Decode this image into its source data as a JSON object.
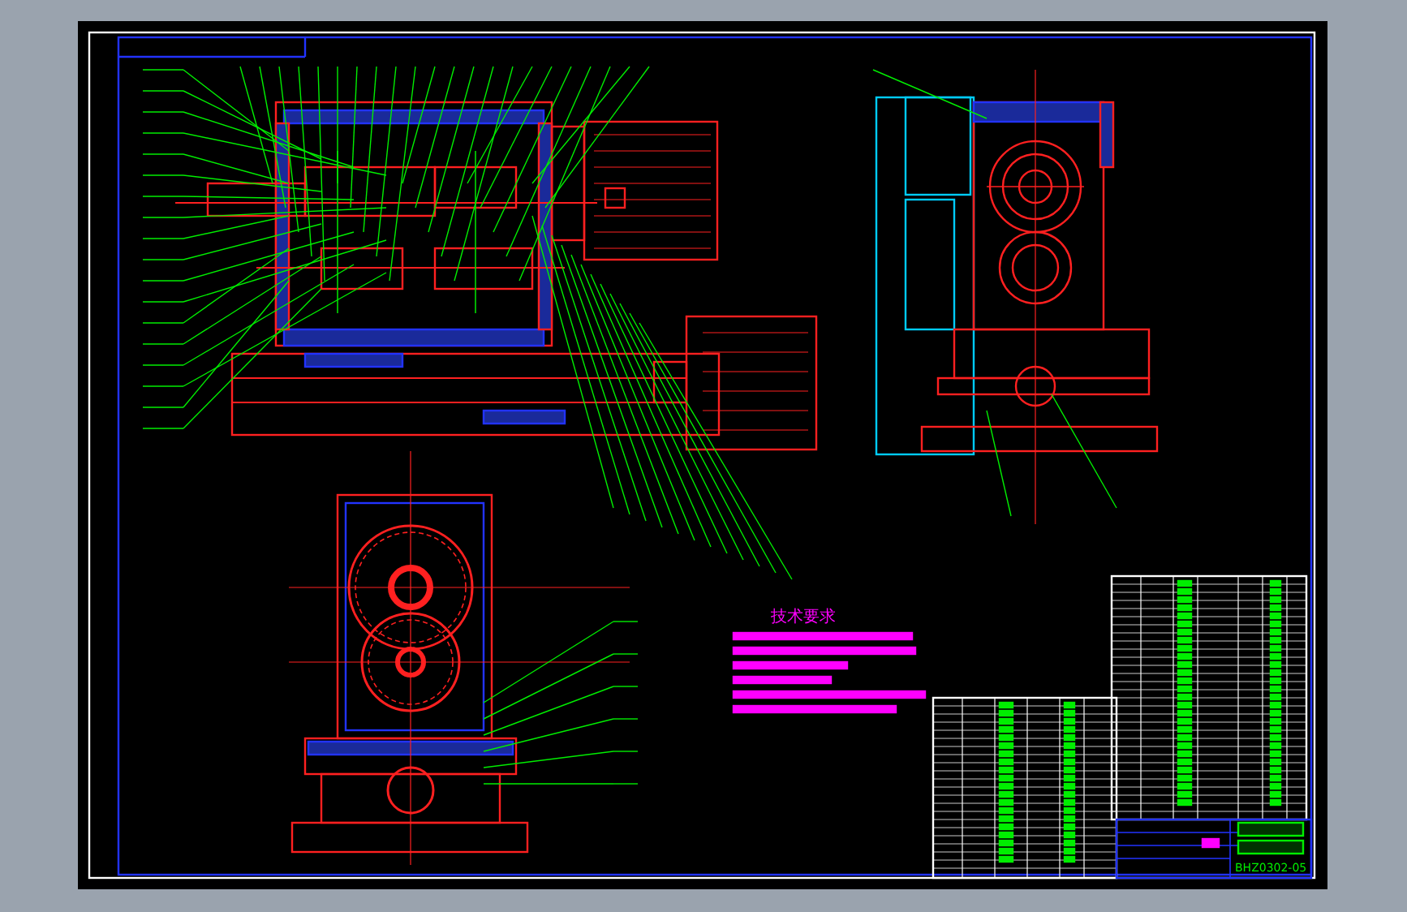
{
  "drawing": {
    "notes_title": "技术要求",
    "drawing_number": "BHZ0302-05"
  }
}
